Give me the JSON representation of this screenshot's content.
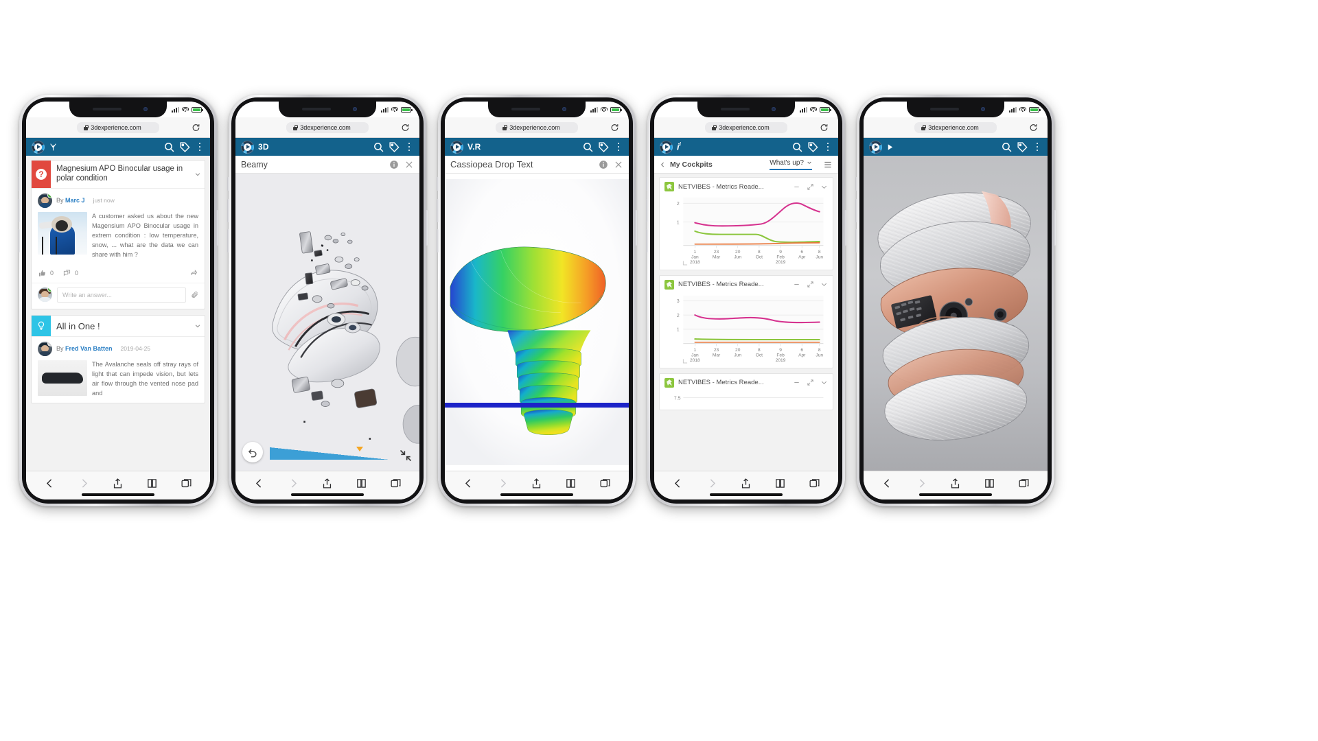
{
  "browser": {
    "url": "3dexperience.com",
    "lock_icon": "lock-icon",
    "reload_icon": "reload-icon",
    "carrier": "",
    "toolbar": {
      "back_icon": "chevron-left-icon",
      "forward_icon": "chevron-right-icon",
      "share_icon": "share-icon",
      "bookmarks_icon": "book-icon",
      "tabs_icon": "tabs-icon"
    }
  },
  "phones": [
    {
      "id": "phone-social",
      "appbar": {
        "logo": "3dexperience-compass-icon",
        "brand": "",
        "brand_icon": "social-antenna-icon",
        "search_icon": "search-icon",
        "tag_icon": "tag-icon",
        "menu_icon": "kebab-menu-icon"
      },
      "feed": {
        "posts": [
          {
            "type_icon": "question-icon",
            "accent": "#e1493f",
            "title": "Magnesium APO Binocular usage in polar condition",
            "by_label": "By",
            "author": "Marc J",
            "timestamp": "just now",
            "body": "A customer asked us about the new Magensium APO Binocular usage in extrem condition : low temperature, snow, ... what are the data we can share with him ?",
            "body_fade_from": "can share with him ?",
            "likes": "0",
            "comments": "0",
            "answer_placeholder": "Write an answer...",
            "collapse_icon": "chevron-down-icon"
          },
          {
            "type_icon": "idea-bulb-icon",
            "accent": "#2ec4e6",
            "title": "All in One !",
            "by_label": "By",
            "author": "Fred Van Batten",
            "timestamp": "2019-04-25",
            "body": "The Avalanche seals off stray rays of light that can impede vision, but lets air flow through the vented nose pad and",
            "collapse_icon": "chevron-down-icon"
          }
        ]
      }
    },
    {
      "id": "phone-3d",
      "appbar": {
        "brand": "3D",
        "search_icon": "search-icon",
        "tag_icon": "tag-icon",
        "menu_icon": "kebab-menu-icon"
      },
      "subheader": {
        "title": "Beamy",
        "info_icon": "info-icon",
        "close_icon": "close-icon"
      },
      "viewer": {
        "undo_icon": "undo-icon",
        "fullscreen_icon": "collapse-arrows-icon",
        "slider_name": "explode-slider",
        "slider_value": "78"
      }
    },
    {
      "id": "phone-vr",
      "appbar": {
        "brand": "V.R",
        "search_icon": "search-icon",
        "tag_icon": "tag-icon",
        "menu_icon": "kebab-menu-icon"
      },
      "subheader": {
        "title": "Cassiopea Drop Text",
        "info_icon": "info-icon",
        "close_icon": "close-icon"
      }
    },
    {
      "id": "phone-dashboard",
      "appbar": {
        "brand": "i",
        "brand_sup": "i",
        "search_icon": "search-icon",
        "tag_icon": "tag-icon",
        "menu_icon": "kebab-menu-icon"
      },
      "cockpit": {
        "back_icon": "chevron-left-icon",
        "label": "My Cockpits",
        "tab": "What's up?",
        "tab_chevron": "chevron-down-icon",
        "list_icon": "list-view-icon"
      },
      "widgets": [
        {
          "title": "NETVIBES - Metrics Reade...",
          "minimize_icon": "minimize-icon",
          "expand_icon": "expand-icon",
          "more_icon": "chevron-down-icon"
        },
        {
          "title": "NETVIBES - Metrics Reade...",
          "minimize_icon": "minimize-icon",
          "expand_icon": "expand-icon",
          "more_icon": "chevron-down-icon"
        },
        {
          "title": "NETVIBES - Metrics Reade...",
          "minimize_icon": "minimize-icon",
          "expand_icon": "expand-icon",
          "more_icon": "chevron-down-icon"
        }
      ]
    },
    {
      "id": "phone-ar",
      "appbar": {
        "brand_icon": "play-triangle-icon",
        "search_icon": "search-icon",
        "tag_icon": "tag-icon",
        "menu_icon": "kebab-menu-icon"
      }
    }
  ],
  "chart_data": [
    {
      "type": "line",
      "title": "NETVIBES - Metrics Reade...",
      "x": [
        "1 Jan 2018",
        "23 Mar",
        "20 Jun",
        "8 Oct",
        "9 Feb 2019",
        "6 Apr",
        "8 Jun"
      ],
      "xtick_top": [
        "1",
        "23",
        "20",
        "8",
        "9",
        "6",
        "8"
      ],
      "xtick_mid": [
        "Jan",
        "Mar",
        "Jun",
        "Oct",
        "Feb",
        "Apr",
        "Jun"
      ],
      "xtick_bot": [
        "2018",
        "",
        "",
        "",
        "2019",
        "",
        ""
      ],
      "yticks": [
        1,
        2
      ],
      "ylim": [
        0,
        2.3
      ],
      "grid": true,
      "legend": "none",
      "series": [
        {
          "name": "magenta",
          "color": "#d6338f",
          "values": [
            1.08,
            0.95,
            0.92,
            0.93,
            1.0,
            1.35,
            1.95,
            1.7
          ]
        },
        {
          "name": "green",
          "color": "#8cc63e",
          "values": [
            0.72,
            0.6,
            0.58,
            0.58,
            0.5,
            0.22,
            0.2,
            0.2
          ]
        },
        {
          "name": "orange",
          "color": "#e8763a",
          "values": [
            0.06,
            0.06,
            0.06,
            0.06,
            0.07,
            0.09,
            0.1,
            0.1
          ]
        }
      ]
    },
    {
      "type": "line",
      "title": "NETVIBES - Metrics Reade...",
      "x": [
        "1 Jan 2018",
        "23 Mar",
        "20 Jun",
        "8 Oct",
        "9 Feb 2019",
        "6 Apr",
        "8 Jun"
      ],
      "xtick_top": [
        "1",
        "23",
        "20",
        "8",
        "9",
        "6",
        "8"
      ],
      "xtick_mid": [
        "Jan",
        "Mar",
        "Jun",
        "Oct",
        "Feb",
        "Apr",
        "Jun"
      ],
      "xtick_bot": [
        "2018",
        "",
        "",
        "",
        "2019",
        "",
        ""
      ],
      "yticks": [
        1,
        2,
        3
      ],
      "ylim": [
        0,
        3.3
      ],
      "grid": true,
      "legend": "none",
      "series": [
        {
          "name": "magenta",
          "color": "#d6338f",
          "values": [
            2.0,
            1.78,
            1.72,
            1.78,
            1.8,
            1.72,
            1.52,
            1.5
          ]
        },
        {
          "name": "green",
          "color": "#8cc63e",
          "values": [
            0.28,
            0.24,
            0.22,
            0.22,
            0.2,
            0.2,
            0.2,
            0.2
          ]
        },
        {
          "name": "orange",
          "color": "#e8763a",
          "values": [
            0.07,
            0.07,
            0.07,
            0.07,
            0.07,
            0.07,
            0.07,
            0.07
          ]
        }
      ]
    },
    {
      "type": "line",
      "title": "NETVIBES - Metrics Reade...",
      "yticks": [
        7.5
      ],
      "ylim": [
        0,
        9
      ],
      "grid": true,
      "legend": "none",
      "series": []
    }
  ],
  "colors": {
    "appbar": "#13628c",
    "question_red": "#e1493f",
    "idea_cyan": "#2ec4e6",
    "link_blue": "#2b7fc4",
    "slider_blue": "#3c9fd6",
    "slider_knob": "#f5a623",
    "sim_bar_blue": "#1c23c8",
    "widget_green": "#8cc63e",
    "tab_underline": "#1b74b8"
  }
}
